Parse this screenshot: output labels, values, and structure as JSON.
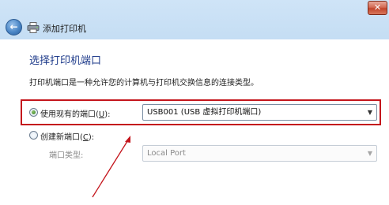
{
  "window": {
    "close_glyph": "✕",
    "back_glyph": "←",
    "title": "添加打印机"
  },
  "page": {
    "heading": "选择打印机端口",
    "description": "打印机端口是一种允许您的计算机与打印机交换信息的连接类型。"
  },
  "options": {
    "use_existing": {
      "label_prefix": "使用现有的端口(",
      "accelerator": "U",
      "label_suffix": "):",
      "selected": true,
      "value": "USB001 (USB 虚拟打印机端口)"
    },
    "create_new": {
      "label_prefix": "创建新端口(",
      "accelerator": "C",
      "label_suffix": "):",
      "selected": false,
      "port_type_label": "端口类型:",
      "port_type_value": "Local Port"
    }
  },
  "icons": {
    "back": "back-arrow-icon",
    "printer": "printer-icon",
    "dropdown": "chevron-down-icon",
    "close": "close-icon"
  },
  "colors": {
    "heading": "#1d3a8a",
    "annotation": "#c4151c",
    "radio_selected": "#2f7d1e"
  }
}
